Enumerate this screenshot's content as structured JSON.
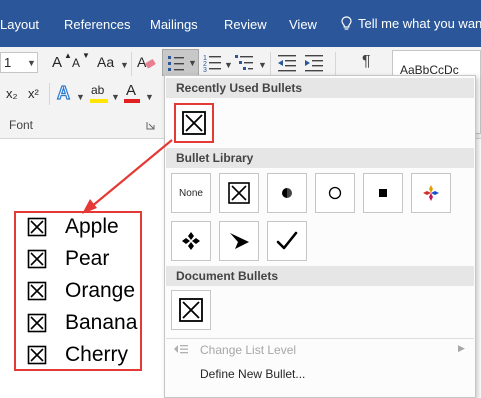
{
  "ribbon_tabs": [
    "Layout",
    "References",
    "Mailings",
    "Review",
    "View"
  ],
  "tell_me": "Tell me what you want",
  "font": {
    "size_value": "1",
    "group_label": "Font",
    "grow_font_label": "A",
    "shrink_font_label": "A",
    "change_case_label": "Aa",
    "subscript_label": "x₂",
    "superscript_label": "x²",
    "text_effects_label": "A",
    "highlight_label": "ab",
    "font_color_label": "A"
  },
  "styles_preview": "AaBbCcDc",
  "paragraph_mark": "¶",
  "menu": {
    "recently_used_header": "Recently Used Bullets",
    "library_header": "Bullet Library",
    "document_header": "Document Bullets",
    "none_label": "None",
    "change_level_label": "Change List Level",
    "define_new_label": "Define New Bullet..."
  },
  "document_list": [
    "Apple",
    "Pear",
    "Orange",
    "Banana",
    "Cherry"
  ],
  "colors": {
    "tab_bar": "#2b579a",
    "highlight_red": "#e53935",
    "text_highlight_yellow": "#ffe600",
    "font_color_red": "#e02020",
    "accent_blue": "#2b579a"
  },
  "icons": {
    "bullets_button": "bullets-icon",
    "numbering_button": "numbering-icon",
    "multilevel_button": "multilevel-list-icon",
    "decrease_indent": "decrease-indent-icon",
    "increase_indent": "increase-indent-icon",
    "clear_formatting": "clear-formatting-icon",
    "bullet_boxed_x": "boxed-x-bullet-icon"
  }
}
